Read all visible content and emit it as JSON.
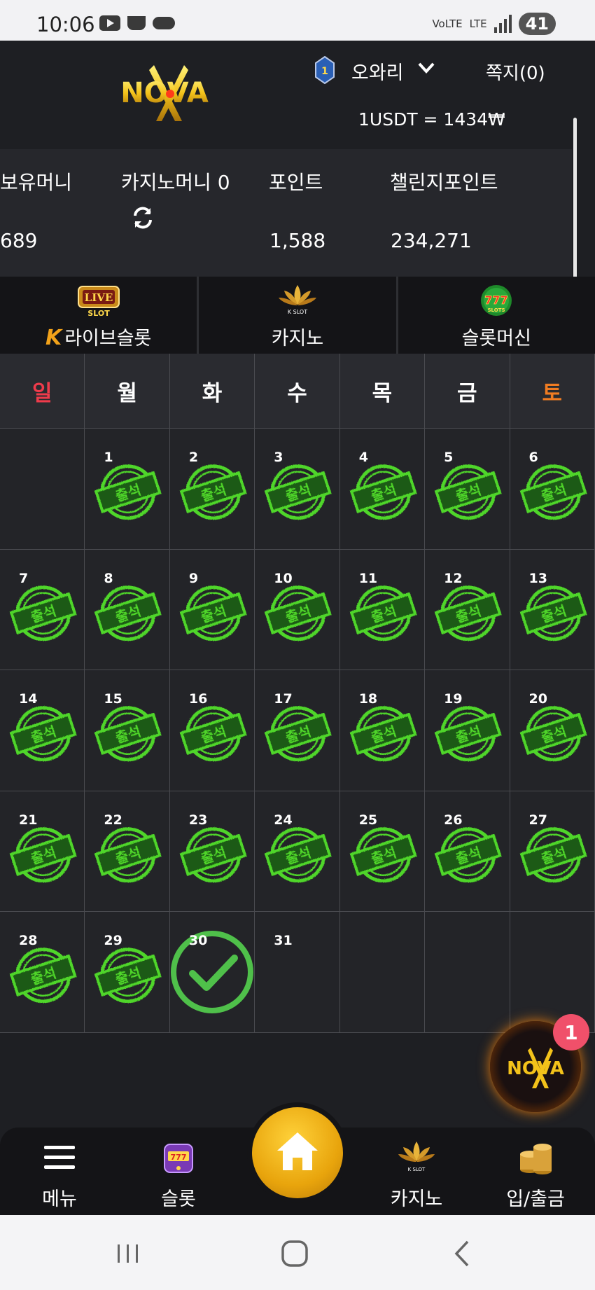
{
  "status_bar": {
    "time": "10:06",
    "network": "LTE",
    "volte": "VoLTE",
    "battery": "41"
  },
  "header": {
    "logo_text": "NOVA",
    "rank_level": "1",
    "user_name": "오와리",
    "memo_label": "쪽지(0)",
    "exchange_rate": "1USDT = 1434₩"
  },
  "balances": {
    "holding_label": "보유머니",
    "holding_value": "689",
    "casino_label": "카지노머니 0",
    "point_label": "포인트",
    "point_value": "1,588",
    "challenge_label": "챌린지포인트",
    "challenge_value": "234,271"
  },
  "categories": [
    {
      "label": "라이브슬롯",
      "prefix": "K",
      "icon": "live-slot-icon",
      "icon_text": "LIVE SLOT"
    },
    {
      "label": "카지노",
      "icon": "kslot-lotus-icon",
      "icon_text": "K SLOT"
    },
    {
      "label": "슬롯머신",
      "icon": "777-slots-icon",
      "icon_text": "777"
    }
  ],
  "calendar": {
    "weekdays": [
      "일",
      "월",
      "화",
      "수",
      "목",
      "금",
      "토"
    ],
    "stamp_text": "출석",
    "days": [
      {
        "n": "",
        "s": "none"
      },
      {
        "n": "1",
        "s": "stamp"
      },
      {
        "n": "2",
        "s": "stamp"
      },
      {
        "n": "3",
        "s": "stamp"
      },
      {
        "n": "4",
        "s": "stamp"
      },
      {
        "n": "5",
        "s": "stamp"
      },
      {
        "n": "6",
        "s": "stamp"
      },
      {
        "n": "7",
        "s": "stamp"
      },
      {
        "n": "8",
        "s": "stamp"
      },
      {
        "n": "9",
        "s": "stamp"
      },
      {
        "n": "10",
        "s": "stamp"
      },
      {
        "n": "11",
        "s": "stamp"
      },
      {
        "n": "12",
        "s": "stamp"
      },
      {
        "n": "13",
        "s": "stamp"
      },
      {
        "n": "14",
        "s": "stamp"
      },
      {
        "n": "15",
        "s": "stamp"
      },
      {
        "n": "16",
        "s": "stamp"
      },
      {
        "n": "17",
        "s": "stamp"
      },
      {
        "n": "18",
        "s": "stamp"
      },
      {
        "n": "19",
        "s": "stamp"
      },
      {
        "n": "20",
        "s": "stamp"
      },
      {
        "n": "21",
        "s": "stamp"
      },
      {
        "n": "22",
        "s": "stamp"
      },
      {
        "n": "23",
        "s": "stamp"
      },
      {
        "n": "24",
        "s": "stamp"
      },
      {
        "n": "25",
        "s": "stamp"
      },
      {
        "n": "26",
        "s": "stamp"
      },
      {
        "n": "27",
        "s": "stamp"
      },
      {
        "n": "28",
        "s": "stamp"
      },
      {
        "n": "29",
        "s": "stamp"
      },
      {
        "n": "30",
        "s": "check"
      },
      {
        "n": "31",
        "s": "none"
      },
      {
        "n": "",
        "s": "none"
      },
      {
        "n": "",
        "s": "none"
      },
      {
        "n": "",
        "s": "none"
      }
    ]
  },
  "floating": {
    "badge_count": "1",
    "logo_text": "NOVA"
  },
  "bottom_nav": {
    "menu_label": "메뉴",
    "slot_label": "슬롯",
    "casino_label": "카지노",
    "deposit_label": "입/출금"
  },
  "colors": {
    "stamp_green": "#4fd62a",
    "check_green": "#4fc04a",
    "sunday": "#ef3b4b",
    "saturday": "#f07c22",
    "gold": "#e8a40c"
  }
}
